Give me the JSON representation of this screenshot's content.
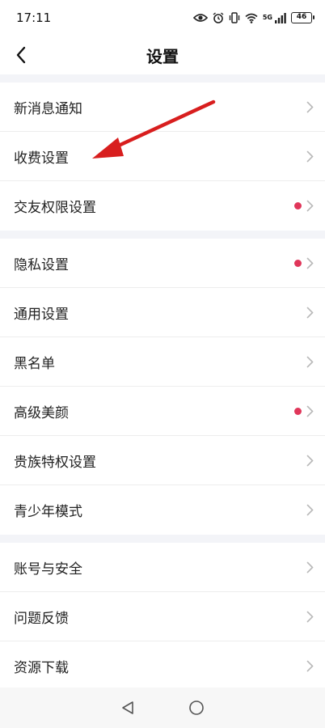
{
  "status": {
    "time": "17:11",
    "battery": "46",
    "network": "5G"
  },
  "header": {
    "title": "设置"
  },
  "groups": [
    {
      "items": [
        {
          "label": "新消息通知",
          "dot": false
        },
        {
          "label": "收费设置",
          "dot": false
        },
        {
          "label": "交友权限设置",
          "dot": true
        }
      ]
    },
    {
      "items": [
        {
          "label": "隐私设置",
          "dot": true
        },
        {
          "label": "通用设置",
          "dot": false
        },
        {
          "label": "黑名单",
          "dot": false
        },
        {
          "label": "高级美颜",
          "dot": true
        },
        {
          "label": "贵族特权设置",
          "dot": false
        },
        {
          "label": "青少年模式",
          "dot": false
        }
      ]
    },
    {
      "items": [
        {
          "label": "账号与安全",
          "dot": false
        },
        {
          "label": "问题反馈",
          "dot": false
        },
        {
          "label": "资源下载",
          "dot": false
        }
      ]
    }
  ],
  "colors": {
    "badge": "#e0365a",
    "annotation_arrow": "#d81e1e",
    "divider_band": "#f3f4f8"
  },
  "icons": {
    "back": "chevron-left-icon",
    "row": "chevron-right-icon",
    "nav_back": "triangle-back-icon",
    "nav_home": "circle-home-icon"
  }
}
